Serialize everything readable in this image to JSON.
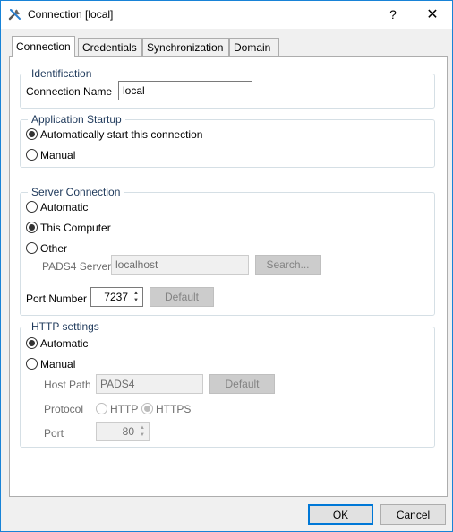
{
  "window": {
    "title": "Connection [local]",
    "help_glyph": "?",
    "close_glyph": "✕"
  },
  "tabs": [
    {
      "label": "Connection",
      "active": true
    },
    {
      "label": "Credentials",
      "active": false
    },
    {
      "label": "Synchronization",
      "active": false
    },
    {
      "label": "Domain",
      "active": false
    }
  ],
  "identification": {
    "title": "Identification",
    "connection_name_label": "Connection Name",
    "connection_name_value": "local"
  },
  "application_startup": {
    "title": "Application Startup",
    "auto_label": "Automatically start this connection",
    "manual_label": "Manual",
    "selected": "auto"
  },
  "server_connection": {
    "title": "Server Connection",
    "automatic_label": "Automatic",
    "this_computer_label": "This Computer",
    "other_label": "Other",
    "selected": "this_computer",
    "server_label": "PADS4 Server",
    "server_value": "localhost",
    "search_label": "Search...",
    "port_label": "Port Number",
    "port_value": "7237",
    "default_label": "Default"
  },
  "http_settings": {
    "title": "HTTP settings",
    "automatic_label": "Automatic",
    "manual_label": "Manual",
    "selected": "automatic",
    "host_path_label": "Host Path",
    "host_path_value": "PADS4",
    "default_label": "Default",
    "protocol_label": "Protocol",
    "http_label": "HTTP",
    "https_label": "HTTPS",
    "protocol_selected": "https",
    "port_label": "Port",
    "port_value": "80"
  },
  "footer": {
    "ok_label": "OK",
    "cancel_label": "Cancel"
  },
  "icons": {
    "app": "tools-icon",
    "help": "help-icon",
    "close": "close-icon",
    "spin_up": "▲",
    "spin_down": "▼"
  },
  "colors": {
    "group_title": "#1e395b",
    "window_border": "#1883d7",
    "default_button_border": "#0078d7"
  }
}
